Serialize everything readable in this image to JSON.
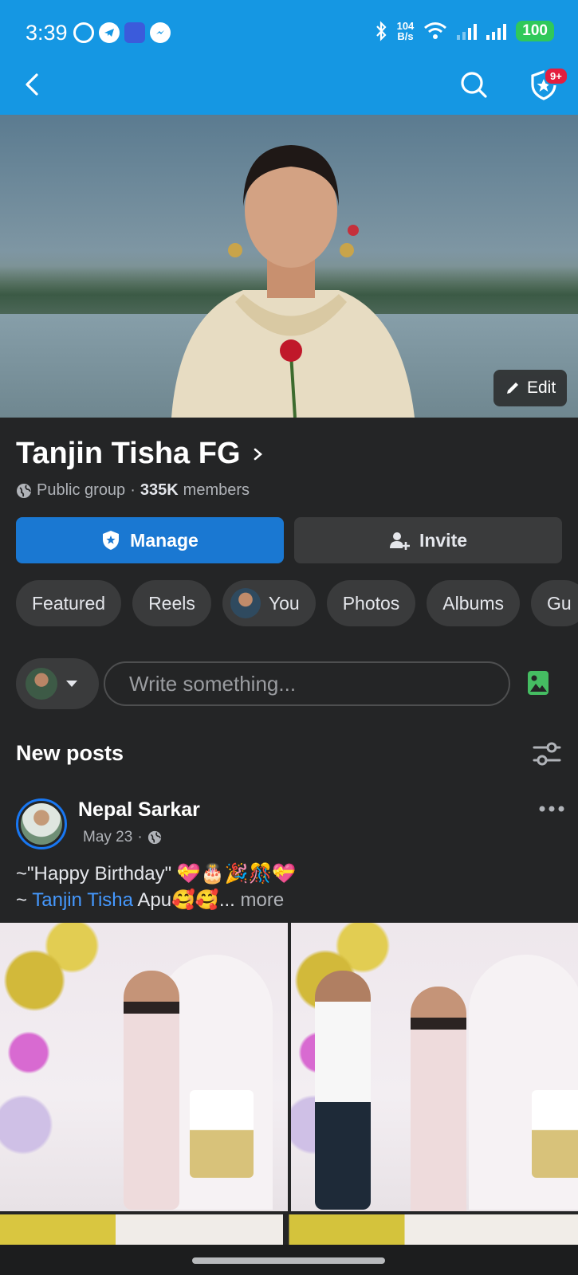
{
  "status_bar": {
    "time": "3:39",
    "speed_value": "104",
    "speed_unit": "B/s",
    "battery": "100"
  },
  "app_bar": {
    "notification_badge": "9+"
  },
  "cover": {
    "edit_label": "Edit"
  },
  "group": {
    "name": "Tanjin Tisha FG",
    "privacy": "Public group",
    "separator": "·",
    "member_count": "335K",
    "member_label": "members"
  },
  "actions": {
    "manage_label": "Manage",
    "invite_label": "Invite"
  },
  "chips": [
    {
      "label": "Featured"
    },
    {
      "label": "Reels"
    },
    {
      "label": "You"
    },
    {
      "label": "Photos"
    },
    {
      "label": "Albums"
    },
    {
      "label": "Gu"
    }
  ],
  "composer": {
    "placeholder": "Write something..."
  },
  "feed": {
    "section_title": "New posts"
  },
  "post": {
    "author": "Nepal Sarkar",
    "date": "May 23",
    "meta_separator": "·",
    "line1": "~\"Happy Birthday\" 💝🎂🎉🎊💝",
    "line2_prefix": "~ ",
    "mention": "Tanjin Tisha",
    "line2_suffix": " Apu🥰🥰",
    "ellipsis": "...",
    "more_label": " more"
  },
  "colors": {
    "accent": "#1597e3",
    "primary_button": "#1a78d2",
    "background": "#242526",
    "mention": "#4599ff",
    "badge": "#e41e3f"
  },
  "icons": {
    "back": "back-arrow-icon",
    "search": "search-icon",
    "notifications": "shield-star-icon",
    "edit": "pencil-icon",
    "manage": "shield-star-icon",
    "invite": "add-person-icon",
    "globe": "globe-icon",
    "photo": "photo-icon",
    "filter": "sliders-icon",
    "more": "more-dots-icon"
  }
}
